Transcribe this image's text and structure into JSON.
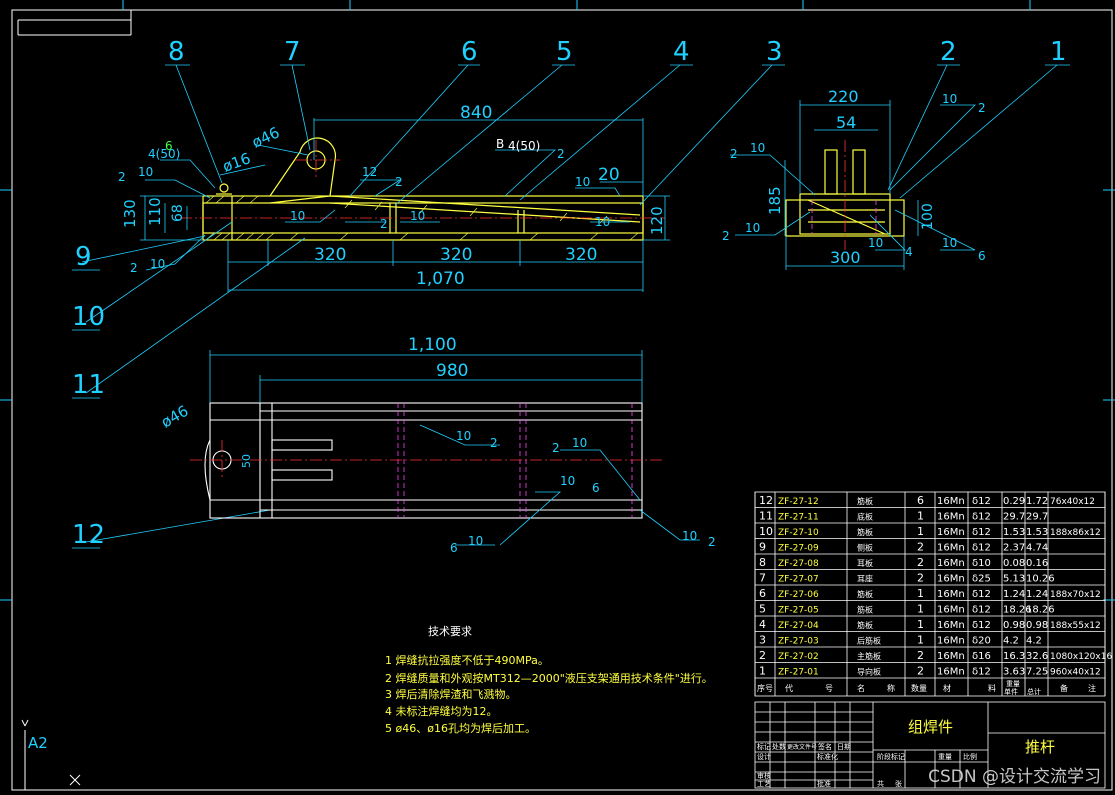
{
  "drawing": {
    "sheet_size": "A2",
    "balloons": [
      "1",
      "2",
      "3",
      "4",
      "5",
      "6",
      "7",
      "8",
      "9",
      "10",
      "11",
      "12"
    ],
    "colors": {
      "background": "#000000",
      "outline": "#ffffff",
      "dimension": "#20d0ff",
      "part": "#ffff40",
      "center": "#ff3030",
      "hidden": "#ff40ff",
      "weld": "#40ff40"
    }
  },
  "front_view": {
    "dims": {
      "overall_top": "840",
      "height_130": "130",
      "height_110": "110",
      "height_68": "68",
      "right_20": "20",
      "right_120": "120",
      "spacing": [
        "320",
        "320",
        "320"
      ],
      "overall_bottom": "1,070",
      "hole_46": "ø46",
      "hole_16": "ø16"
    },
    "welds": [
      "10",
      "10",
      "10",
      "10",
      "10",
      "2",
      "2",
      "2",
      "12",
      "2",
      "B",
      "4(50)",
      "2",
      "6"
    ]
  },
  "side_view": {
    "dims": {
      "top": "220",
      "inner": "54",
      "height": "185",
      "right": "100",
      "bottom": "300"
    },
    "welds": [
      "10",
      "2",
      "10",
      "2",
      "10",
      "2",
      "10",
      "4",
      "10",
      "6"
    ]
  },
  "top_view": {
    "dims": {
      "overall": "1,100",
      "inner": "980",
      "hole": "ø46",
      "small": "50"
    },
    "welds": [
      "10",
      "2",
      "2",
      "10",
      "10",
      "6",
      "6",
      "10",
      "10",
      "2"
    ]
  },
  "notes": {
    "title": "技术要求",
    "items": [
      "1  焊缝抗拉强度不低于490MPa。",
      "2  焊缝质量和外观按MT312—2000\"液压支架通用技术条件\"进行。",
      "3  焊后清除焊渣和飞溅物。",
      "4  未标注焊缝均为12。",
      "5  ø46、ø16孔均为焊后加工。"
    ]
  },
  "bom": {
    "header": [
      "序号",
      "代",
      "号",
      "名",
      "称",
      "数量",
      "材",
      "料",
      "单件",
      "总计",
      "备",
      "注"
    ],
    "weight_label": "重量",
    "rows": [
      {
        "no": "12",
        "code": "ZF-27-12",
        "name": "筋板",
        "qty": "6",
        "mat": "16Mn",
        "spec": "δ12",
        "unit": "0.29",
        "total": "1.72",
        "note": "76x40x12"
      },
      {
        "no": "11",
        "code": "ZF-27-11",
        "name": "底板",
        "qty": "1",
        "mat": "16Mn",
        "spec": "δ12",
        "unit": "29.7",
        "total": "29.7",
        "note": ""
      },
      {
        "no": "10",
        "code": "ZF-27-10",
        "name": "筋板",
        "qty": "1",
        "mat": "16Mn",
        "spec": "δ12",
        "unit": "1.53",
        "total": "1.53",
        "note": "188x86x12"
      },
      {
        "no": "9",
        "code": "ZF-27-09",
        "name": "侧板",
        "qty": "2",
        "mat": "16Mn",
        "spec": "δ12",
        "unit": "2.37",
        "total": "4.74",
        "note": ""
      },
      {
        "no": "8",
        "code": "ZF-27-08",
        "name": "耳板",
        "qty": "2",
        "mat": "16Mn",
        "spec": "δ10",
        "unit": "0.08",
        "total": "0.16",
        "note": ""
      },
      {
        "no": "7",
        "code": "ZF-27-07",
        "name": "耳座",
        "qty": "2",
        "mat": "16Mn",
        "spec": "δ25",
        "unit": "5.13",
        "total": "10.26",
        "note": ""
      },
      {
        "no": "6",
        "code": "ZF-27-06",
        "name": "筋板",
        "qty": "1",
        "mat": "16Mn",
        "spec": "δ12",
        "unit": "1.24",
        "total": "1.24",
        "note": "188x70x12"
      },
      {
        "no": "5",
        "code": "ZF-27-05",
        "name": "筋板",
        "qty": "1",
        "mat": "16Mn",
        "spec": "δ12",
        "unit": "18.26",
        "total": "18.26",
        "note": ""
      },
      {
        "no": "4",
        "code": "ZF-27-04",
        "name": "筋板",
        "qty": "1",
        "mat": "16Mn",
        "spec": "δ12",
        "unit": "0.98",
        "total": "0.98",
        "note": "188x55x12"
      },
      {
        "no": "3",
        "code": "ZF-27-03",
        "name": "后筋板",
        "qty": "1",
        "mat": "16Mn",
        "spec": "δ20",
        "unit": "4.2",
        "total": "4.2",
        "note": ""
      },
      {
        "no": "2",
        "code": "ZF-27-02",
        "name": "主筋板",
        "qty": "2",
        "mat": "16Mn",
        "spec": "δ16",
        "unit": "16.3",
        "total": "32.6",
        "note": "1080x120x16"
      },
      {
        "no": "1",
        "code": "ZF-27-01",
        "name": "导向板",
        "qty": "2",
        "mat": "16Mn",
        "spec": "δ12",
        "unit": "3.63",
        "total": "7.25",
        "note": "960x40x12"
      }
    ]
  },
  "title_block": {
    "drawing_name": "组焊件",
    "part_name": "推杆",
    "labels": [
      "标记",
      "处数",
      "更改文件号",
      "签名",
      "日期",
      "设计",
      "标准化",
      "审核",
      "工艺",
      "批准",
      "日期",
      "阶段标记",
      "重量",
      "比例",
      "共",
      "张",
      "第",
      "张"
    ]
  },
  "watermark": "CSDN @设计交流学习"
}
